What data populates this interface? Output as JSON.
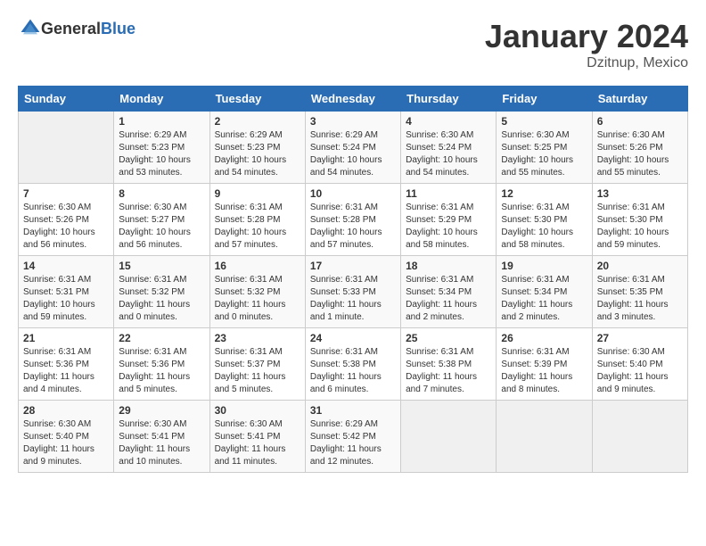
{
  "header": {
    "logo_general": "General",
    "logo_blue": "Blue",
    "month": "January 2024",
    "location": "Dzitnup, Mexico"
  },
  "days_of_week": [
    "Sunday",
    "Monday",
    "Tuesday",
    "Wednesday",
    "Thursday",
    "Friday",
    "Saturday"
  ],
  "weeks": [
    [
      {
        "day": "",
        "info": ""
      },
      {
        "day": "1",
        "info": "Sunrise: 6:29 AM\nSunset: 5:23 PM\nDaylight: 10 hours\nand 53 minutes."
      },
      {
        "day": "2",
        "info": "Sunrise: 6:29 AM\nSunset: 5:23 PM\nDaylight: 10 hours\nand 54 minutes."
      },
      {
        "day": "3",
        "info": "Sunrise: 6:29 AM\nSunset: 5:24 PM\nDaylight: 10 hours\nand 54 minutes."
      },
      {
        "day": "4",
        "info": "Sunrise: 6:30 AM\nSunset: 5:24 PM\nDaylight: 10 hours\nand 54 minutes."
      },
      {
        "day": "5",
        "info": "Sunrise: 6:30 AM\nSunset: 5:25 PM\nDaylight: 10 hours\nand 55 minutes."
      },
      {
        "day": "6",
        "info": "Sunrise: 6:30 AM\nSunset: 5:26 PM\nDaylight: 10 hours\nand 55 minutes."
      }
    ],
    [
      {
        "day": "7",
        "info": "Sunrise: 6:30 AM\nSunset: 5:26 PM\nDaylight: 10 hours\nand 56 minutes."
      },
      {
        "day": "8",
        "info": "Sunrise: 6:30 AM\nSunset: 5:27 PM\nDaylight: 10 hours\nand 56 minutes."
      },
      {
        "day": "9",
        "info": "Sunrise: 6:31 AM\nSunset: 5:28 PM\nDaylight: 10 hours\nand 57 minutes."
      },
      {
        "day": "10",
        "info": "Sunrise: 6:31 AM\nSunset: 5:28 PM\nDaylight: 10 hours\nand 57 minutes."
      },
      {
        "day": "11",
        "info": "Sunrise: 6:31 AM\nSunset: 5:29 PM\nDaylight: 10 hours\nand 58 minutes."
      },
      {
        "day": "12",
        "info": "Sunrise: 6:31 AM\nSunset: 5:30 PM\nDaylight: 10 hours\nand 58 minutes."
      },
      {
        "day": "13",
        "info": "Sunrise: 6:31 AM\nSunset: 5:30 PM\nDaylight: 10 hours\nand 59 minutes."
      }
    ],
    [
      {
        "day": "14",
        "info": "Sunrise: 6:31 AM\nSunset: 5:31 PM\nDaylight: 10 hours\nand 59 minutes."
      },
      {
        "day": "15",
        "info": "Sunrise: 6:31 AM\nSunset: 5:32 PM\nDaylight: 11 hours\nand 0 minutes."
      },
      {
        "day": "16",
        "info": "Sunrise: 6:31 AM\nSunset: 5:32 PM\nDaylight: 11 hours\nand 0 minutes."
      },
      {
        "day": "17",
        "info": "Sunrise: 6:31 AM\nSunset: 5:33 PM\nDaylight: 11 hours\nand 1 minute."
      },
      {
        "day": "18",
        "info": "Sunrise: 6:31 AM\nSunset: 5:34 PM\nDaylight: 11 hours\nand 2 minutes."
      },
      {
        "day": "19",
        "info": "Sunrise: 6:31 AM\nSunset: 5:34 PM\nDaylight: 11 hours\nand 2 minutes."
      },
      {
        "day": "20",
        "info": "Sunrise: 6:31 AM\nSunset: 5:35 PM\nDaylight: 11 hours\nand 3 minutes."
      }
    ],
    [
      {
        "day": "21",
        "info": "Sunrise: 6:31 AM\nSunset: 5:36 PM\nDaylight: 11 hours\nand 4 minutes."
      },
      {
        "day": "22",
        "info": "Sunrise: 6:31 AM\nSunset: 5:36 PM\nDaylight: 11 hours\nand 5 minutes."
      },
      {
        "day": "23",
        "info": "Sunrise: 6:31 AM\nSunset: 5:37 PM\nDaylight: 11 hours\nand 5 minutes."
      },
      {
        "day": "24",
        "info": "Sunrise: 6:31 AM\nSunset: 5:38 PM\nDaylight: 11 hours\nand 6 minutes."
      },
      {
        "day": "25",
        "info": "Sunrise: 6:31 AM\nSunset: 5:38 PM\nDaylight: 11 hours\nand 7 minutes."
      },
      {
        "day": "26",
        "info": "Sunrise: 6:31 AM\nSunset: 5:39 PM\nDaylight: 11 hours\nand 8 minutes."
      },
      {
        "day": "27",
        "info": "Sunrise: 6:30 AM\nSunset: 5:40 PM\nDaylight: 11 hours\nand 9 minutes."
      }
    ],
    [
      {
        "day": "28",
        "info": "Sunrise: 6:30 AM\nSunset: 5:40 PM\nDaylight: 11 hours\nand 9 minutes."
      },
      {
        "day": "29",
        "info": "Sunrise: 6:30 AM\nSunset: 5:41 PM\nDaylight: 11 hours\nand 10 minutes."
      },
      {
        "day": "30",
        "info": "Sunrise: 6:30 AM\nSunset: 5:41 PM\nDaylight: 11 hours\nand 11 minutes."
      },
      {
        "day": "31",
        "info": "Sunrise: 6:29 AM\nSunset: 5:42 PM\nDaylight: 11 hours\nand 12 minutes."
      },
      {
        "day": "",
        "info": ""
      },
      {
        "day": "",
        "info": ""
      },
      {
        "day": "",
        "info": ""
      }
    ]
  ]
}
